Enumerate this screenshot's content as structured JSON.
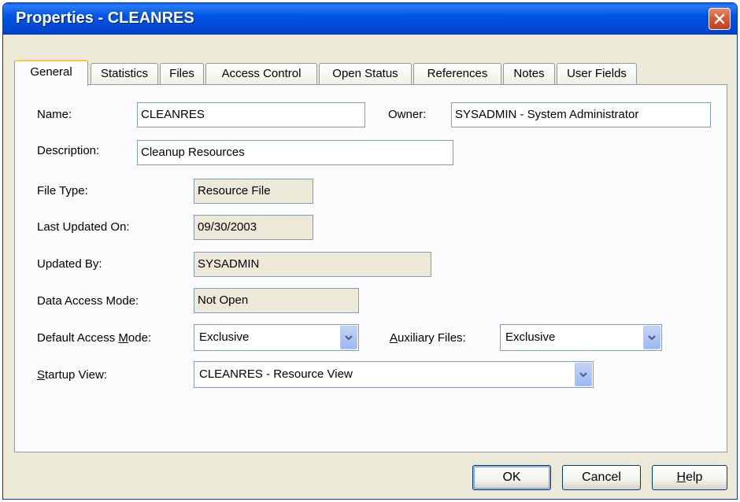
{
  "window": {
    "title": "Properties - CLEANRES"
  },
  "tabs": [
    {
      "label": "General"
    },
    {
      "label": "Statistics"
    },
    {
      "label": "Files"
    },
    {
      "label": "Access Control"
    },
    {
      "label": "Open Status"
    },
    {
      "label": "References"
    },
    {
      "label": "Notes"
    },
    {
      "label": "User Fields"
    }
  ],
  "general": {
    "name_label": "Name:",
    "name_value": "CLEANRES",
    "owner_label": "Owner:",
    "owner_value": "SYSADMIN - System Administrator",
    "description_label": "Description:",
    "description_value": "Cleanup Resources",
    "file_type_label": "File Type:",
    "file_type_value": "Resource File",
    "last_updated_label": "Last Updated On:",
    "last_updated_value": "09/30/2003",
    "updated_by_label": "Updated By:",
    "updated_by_value": "SYSADMIN",
    "data_access_label": "Data Access Mode:",
    "data_access_value": "Not Open",
    "default_access_label": "Default Access Mode:",
    "default_access_value": "Exclusive",
    "auxiliary_label": "Auxiliary Files:",
    "auxiliary_value": "Exclusive",
    "startup_view_label": "Startup View:",
    "startup_view_value": "CLEANRES - Resource View"
  },
  "buttons": {
    "ok": "OK",
    "cancel": "Cancel",
    "help": "Help"
  },
  "icons": {
    "close": "close-icon",
    "dropdown": "chevron-down-icon"
  },
  "colors": {
    "title_bar": "#0055e5",
    "dialog_bg": "#ece9d8",
    "close_button": "#d95a32",
    "active_tab_highlight": "#ffc83c"
  }
}
